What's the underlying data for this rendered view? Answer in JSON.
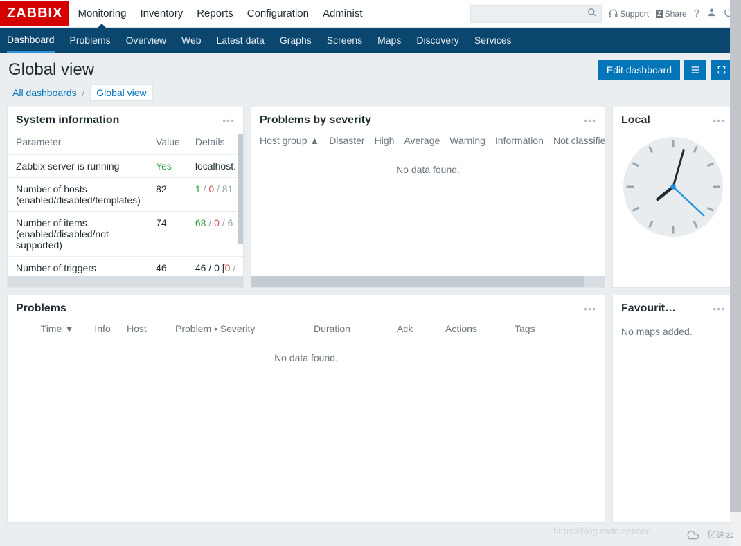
{
  "brand": "ZABBIX",
  "topnav": [
    "Monitoring",
    "Inventory",
    "Reports",
    "Configuration",
    "Administ"
  ],
  "tools": {
    "support": "Support",
    "share": "Share",
    "help": "?"
  },
  "subnav": [
    "Dashboard",
    "Problems",
    "Overview",
    "Web",
    "Latest data",
    "Graphs",
    "Screens",
    "Maps",
    "Discovery",
    "Services"
  ],
  "page_title": "Global view",
  "edit_btn": "Edit dashboard",
  "crumb": {
    "all": "All dashboards",
    "sep": "/",
    "cur": "Global view"
  },
  "sysinfo": {
    "title": "System information",
    "headers": [
      "Parameter",
      "Value",
      "Details"
    ],
    "rows": [
      {
        "param": "Zabbix server is running",
        "value": "Yes",
        "value_cls": "yes",
        "details": "localhost:"
      },
      {
        "param": "Number of hosts (enabled/disabled/templates)",
        "value": "82",
        "details_parts": [
          [
            "1",
            "green"
          ],
          [
            " / ",
            "grey"
          ],
          [
            "0",
            "red"
          ],
          [
            " / ",
            "grey"
          ],
          [
            "81",
            "grey"
          ]
        ]
      },
      {
        "param": "Number of items (enabled/disabled/not supported)",
        "value": "74",
        "details_parts": [
          [
            "68",
            "green"
          ],
          [
            " / ",
            "grey"
          ],
          [
            "0",
            "red"
          ],
          [
            " / ",
            "grey"
          ],
          [
            "6",
            "grey"
          ]
        ]
      },
      {
        "param": "Number of triggers",
        "value": "46",
        "details_parts": [
          [
            "46",
            ""
          ],
          [
            " / ",
            ""
          ],
          [
            "0",
            ""
          ],
          [
            " [",
            ""
          ],
          [
            "0",
            "red"
          ],
          [
            " /",
            "grey"
          ]
        ]
      }
    ]
  },
  "pbsev": {
    "title": "Problems by severity",
    "cols": [
      "Host group ▲",
      "Disaster",
      "High",
      "Average",
      "Warning",
      "Information",
      "Not classifie"
    ],
    "nodata": "No data found."
  },
  "local": {
    "title": "Local"
  },
  "problems": {
    "title": "Problems",
    "cols": [
      "Time ▼",
      "Info",
      "Host",
      "Problem • Severity",
      "Duration",
      "Ack",
      "Actions",
      "Tags"
    ],
    "nodata": "No data found."
  },
  "fav": {
    "title": "Favourit…",
    "body": "No maps added."
  },
  "watermark_url": "https://blog.csdn.net/cao",
  "watermark": "亿速云"
}
